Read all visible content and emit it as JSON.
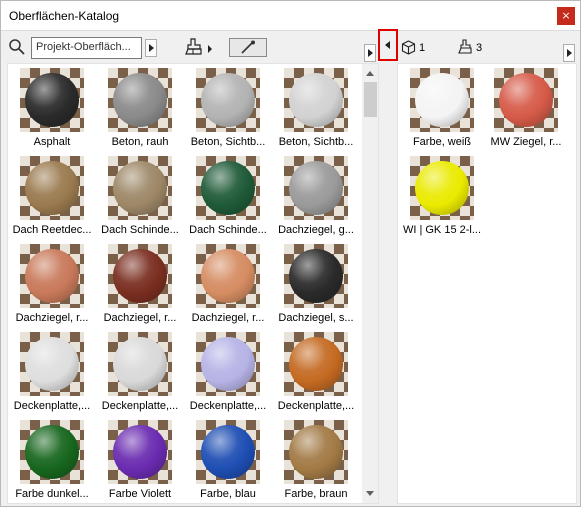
{
  "window": {
    "title": "Oberflächen-Katalog",
    "close_glyph": "×"
  },
  "toolbar": {
    "search_value": "Projekt-Oberfläch...",
    "left_count_icon": "cube-icon",
    "left_count": "1",
    "right_count_icon": "brush-icon",
    "right_count": "3"
  },
  "catalog": {
    "items": [
      {
        "label": "Asphalt",
        "color": "#2a2a2a"
      },
      {
        "label": "Beton, rauh",
        "color": "#8a8a8a"
      },
      {
        "label": "Beton, Sichtb...",
        "color": "#b3b3b3"
      },
      {
        "label": "Beton, Sichtb...",
        "color": "#d2d2d2"
      },
      {
        "label": "Dach Reetdec...",
        "color": "#9a7a4f"
      },
      {
        "label": "Dach Schinde...",
        "color": "#9d8767"
      },
      {
        "label": "Dach Schinde...",
        "color": "#1f5a38"
      },
      {
        "label": "Dachziegel, g...",
        "color": "#9a9a9a"
      },
      {
        "label": "Dachziegel, r...",
        "color": "#c8795a"
      },
      {
        "label": "Dachziegel, r...",
        "color": "#7a2e20"
      },
      {
        "label": "Dachziegel, r...",
        "color": "#d58c62"
      },
      {
        "label": "Dachziegel, s...",
        "color": "#2a2a2a"
      },
      {
        "label": "Deckenplatte,...",
        "color": "#dedede"
      },
      {
        "label": "Deckenplatte,...",
        "color": "#d9d9d9"
      },
      {
        "label": "Deckenplatte,...",
        "color": "#b6b3e6"
      },
      {
        "label": "Deckenplatte,...",
        "color": "#c46a22"
      },
      {
        "label": "Farbe dunkel...",
        "color": "#17661e"
      },
      {
        "label": "Farbe Violett",
        "color": "#6a2bb0"
      },
      {
        "label": "Farbe, blau",
        "color": "#1e4eb3"
      },
      {
        "label": "Farbe, braun",
        "color": "#a27a45"
      }
    ]
  },
  "project": {
    "items": [
      {
        "label": "Farbe, weiß",
        "color": "#f4f4f4"
      },
      {
        "label": "MW Ziegel, r...",
        "color": "#d65a48"
      },
      {
        "label": "WI | GK 15 2-l...",
        "color": "#eaea00"
      }
    ]
  }
}
